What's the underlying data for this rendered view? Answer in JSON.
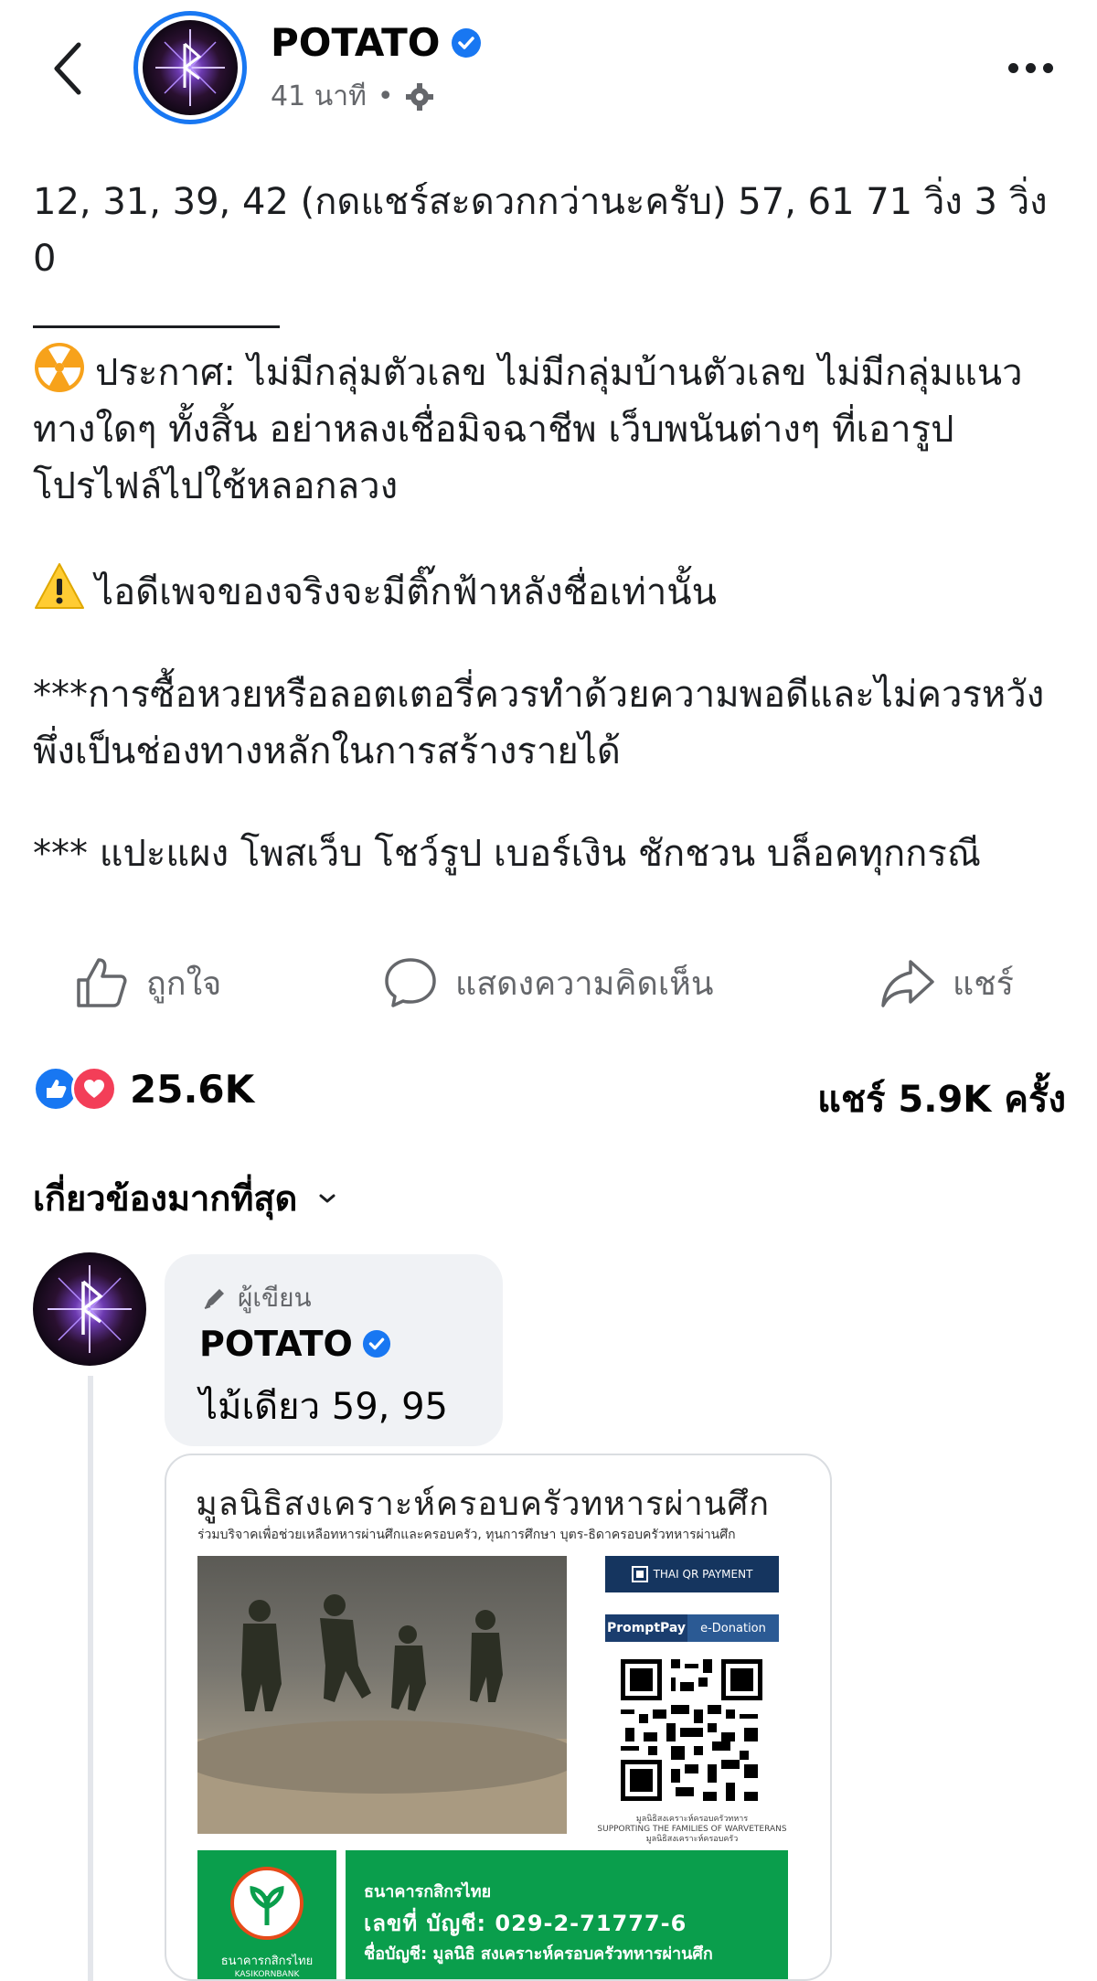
{
  "header": {
    "page_name": "POTATO",
    "time_ago": "41 นาที",
    "separator": "•"
  },
  "post": {
    "line1": "12, 31, 39, 42 (กดแชร์สะดวกกว่านะครับ) 57, 61 71 วิ่ง 3 วิ่ง 0",
    "announcement": "ประกาศ: ไม่มีกลุ่มตัวเลข ไม่มีกลุ่มบ้านตัวเลข ไม่มีกลุ่มแนวทางใดๆ ทั้งสิ้น อย่าหลงเชื่อมิจฉาชีพ เว็บพนันต่างๆ ที่เอารูปโปรไฟล์ไปใช้หลอกลวง",
    "warning": "ไอดีเพจของจริงจะมีติ๊กฟ้าหลังชื่อเท่านั้น",
    "lottery_note": "***การซื้อหวยหรือลอตเตอรี่ควรทำด้วยความพอดีและไม่ควรหวังพึ่งเป็นช่องทางหลักในการสร้างรายได้",
    "block_note": "*** แปะแผง โพสเว็บ โชว์รูป เบอร์เงิน ชักชวน บล็อคทุกกรณี"
  },
  "actions": {
    "like": "ถูกใจ",
    "comment": "แสดงความคิดเห็น",
    "share": "แชร์"
  },
  "stats": {
    "reactions": "25.6K",
    "shares": "แชร์ 5.9K ครั้ง"
  },
  "sort": {
    "label": "เกี่ยวข้องมากที่สุด"
  },
  "comment": {
    "author_tag": "ผู้เขียน",
    "name": "POTATO",
    "text": "ไม้เดียว 59, 95",
    "attachment": {
      "title": "มูลนิธิสงเคราะห์ครอบครัวทหารผ่านศึก",
      "subtitle": "ร่วมบริจาคเพื่อช่วยเหลือทหารผ่านศึกและครอบครัว, ทุนการศึกษา บุตร-ธิดาครอบครัวทหารผ่านศึก",
      "thai_qr": "THAI QR PAYMENT",
      "promptpay": "PromptPay",
      "edonation": "e-Donation",
      "qr_caption_1": "มูลนิธิสงเคราะห์ครอบครัวทหาร",
      "qr_caption_2": "SUPPORTING THE FAMILIES OF WARVETERANS",
      "qr_caption_3": "มูลนิธิสงเคราะห์ครอบครัว",
      "bank_left_label": "ธนาคารกสิกรไทย",
      "bank_left_sub": "KASIKORNBANK",
      "bank_name": "ธนาคารกสิกรไทย",
      "account": "เลขที่ บัญชี: 029-2-71777-6",
      "holder": "ชื่อบัญชี: มูลนิธิ สงเคราะห์ครอบครัวทหารผ่านศึก"
    }
  },
  "colors": {
    "verified": "#1877f2",
    "like": "#1877f2",
    "love": "#f33e58",
    "bank_green": "#0a9e4c"
  },
  "icons": [
    "back-arrow-icon",
    "verified-badge-icon",
    "gear-icon",
    "more-icon",
    "radioactive-emoji-icon",
    "warning-emoji-icon",
    "thumbs-up-icon",
    "comment-bubble-icon",
    "share-arrow-icon",
    "like-reaction-icon",
    "love-reaction-icon",
    "chevron-down-icon",
    "author-pen-icon"
  ]
}
